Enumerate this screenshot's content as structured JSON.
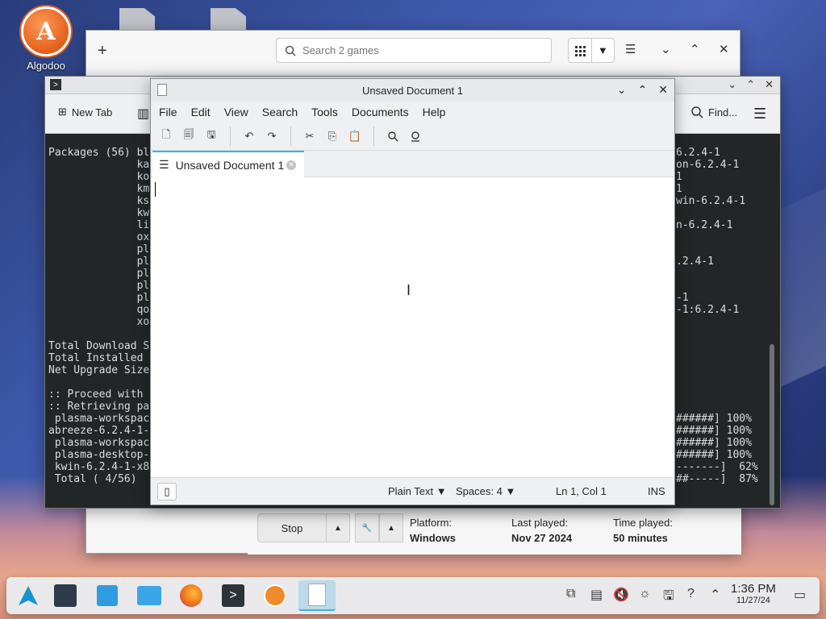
{
  "desktop": {
    "icons": [
      {
        "label": "Algodoo"
      }
    ]
  },
  "games_window": {
    "search_placeholder": "Search 2 games",
    "footer": {
      "stop_label": "Stop",
      "platform_label": "Platform:",
      "platform_value": "Windows",
      "last_played_label": "Last played:",
      "last_played_value": "Nov 27 2024",
      "time_played_label": "Time played:",
      "time_played_value": "50 minutes"
    }
  },
  "terminal": {
    "toolbar": {
      "new_tab_label": "New Tab",
      "find_label": "Find..."
    },
    "lines_left": [
      "Packages (56) bl",
      "              ka",
      "              ko",
      "              km",
      "              ks",
      "              kw",
      "              li",
      "              ox",
      "              pl",
      "              pl",
      "              pl",
      "              pl",
      "              pl",
      "              qo",
      "              xo",
      "",
      "Total Download S",
      "Total Installed ",
      "Net Upgrade Size",
      "",
      ":: Proceed with ",
      ":: Retrieving pa",
      " plasma-workspac",
      "abreeze-6.2.4-1-",
      " plasma-workspac",
      " plasma-desktop-",
      " kwin-6.2.4-1-x8",
      " Total ( 4/56) "
    ],
    "lines_right": [
      "6.2.4-1",
      "on-6.2.4-1",
      "1",
      "1",
      "win-6.2.4-1",
      "",
      "n-6.2.4-1",
      "",
      "",
      ".2.4-1",
      "",
      "",
      "-1",
      "-1:6.2.4-1",
      "",
      "",
      "",
      "",
      "",
      "",
      "",
      "",
      "######] 100%",
      "######] 100%",
      "######] 100%",
      "######] 100%",
      "-------]  62%",
      "##-----]  87%"
    ]
  },
  "editor": {
    "title": "Unsaved Document 1",
    "menu": [
      "File",
      "Edit",
      "View",
      "Search",
      "Tools",
      "Documents",
      "Help"
    ],
    "tab_label": "Unsaved Document 1",
    "status": {
      "language": "Plain Text",
      "spaces": "Spaces: 4",
      "position": "Ln 1, Col 1",
      "mode": "INS"
    }
  },
  "taskbar": {
    "clock_time": "1:36 PM",
    "clock_date": "11/27/24"
  }
}
